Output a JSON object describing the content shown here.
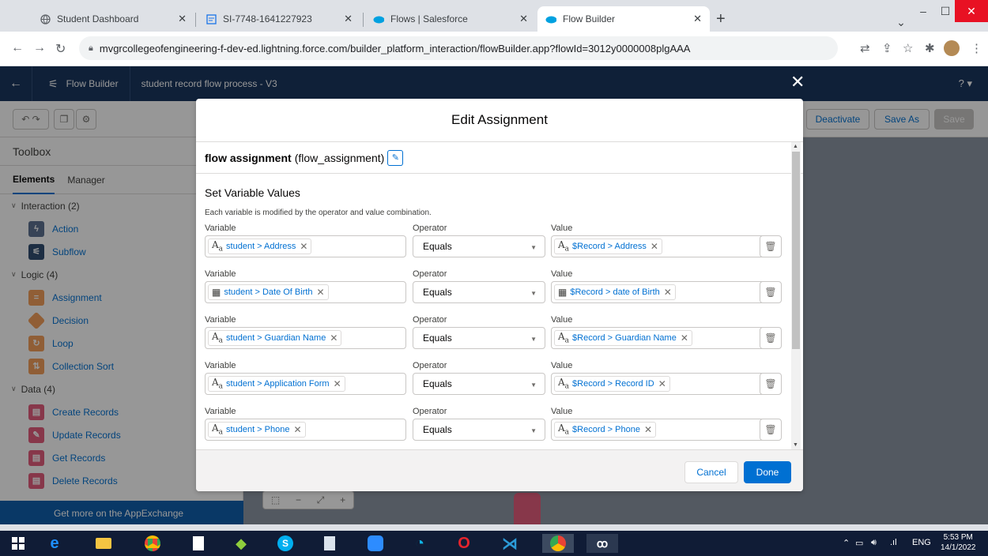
{
  "browser": {
    "tabs": [
      {
        "title": "Student Dashboard"
      },
      {
        "title": "SI-7748-1641227923"
      },
      {
        "title": "Flows | Salesforce"
      },
      {
        "title": "Flow Builder"
      }
    ],
    "url": "mvgrcollegeofengineering-f-dev-ed.lightning.force.com/builder_platform_interaction/flowBuilder.app?flowId=3012y0000008plgAAA"
  },
  "header": {
    "app": "Flow Builder",
    "flow_name": "student record flow process - V3",
    "help": "? ▾"
  },
  "toolbar": {
    "deactivate": "Deactivate",
    "save_as": "Save As",
    "save": "Save"
  },
  "toolbox": {
    "title": "Toolbox",
    "tab_elements": "Elements",
    "tab_manager": "Manager",
    "groups": [
      {
        "label": "Interaction (2)",
        "items": [
          {
            "label": "Action",
            "color": "#5a6f8f"
          },
          {
            "label": "Subflow",
            "color": "#2e4a6e"
          }
        ]
      },
      {
        "label": "Logic (4)",
        "items": [
          {
            "label": "Assignment",
            "color": "#f39e58"
          },
          {
            "label": "Decision",
            "color": "#f39e58"
          },
          {
            "label": "Loop",
            "color": "#f39e58"
          },
          {
            "label": "Collection Sort",
            "color": "#f39e58"
          }
        ]
      },
      {
        "label": "Data (4)",
        "items": [
          {
            "label": "Create Records",
            "color": "#e45a7a"
          },
          {
            "label": "Update Records",
            "color": "#e45a7a"
          },
          {
            "label": "Get Records",
            "color": "#e45a7a"
          },
          {
            "label": "Delete Records",
            "color": "#e45a7a"
          }
        ]
      }
    ],
    "appexchange": "Get more on the AppExchange"
  },
  "modal": {
    "title": "Edit Assignment",
    "api_label": "flow assignment",
    "api_name": "(flow_assignment)",
    "section_title": "Set Variable Values",
    "section_desc": "Each variable is modified by the operator and value combination.",
    "col_variable": "Variable",
    "col_operator": "Operator",
    "col_value": "Value",
    "rows": [
      {
        "variable": "student > Address",
        "var_type": "text",
        "operator": "Equals",
        "value": "$Record > Address",
        "val_type": "text"
      },
      {
        "variable": "student > Date Of Birth",
        "var_type": "date",
        "operator": "Equals",
        "value": "$Record > date of Birth",
        "val_type": "date"
      },
      {
        "variable": "student > Guardian Name",
        "var_type": "text",
        "operator": "Equals",
        "value": "$Record > Guardian Name",
        "val_type": "text"
      },
      {
        "variable": "student > Application Form",
        "var_type": "text",
        "operator": "Equals",
        "value": "$Record > Record ID",
        "val_type": "text"
      },
      {
        "variable": "student > Phone",
        "var_type": "text",
        "operator": "Equals",
        "value": "$Record > Phone",
        "val_type": "text"
      }
    ],
    "cancel": "Cancel",
    "done": "Done"
  },
  "taskbar": {
    "lang": "ENG",
    "time": "5:53 PM",
    "date": "14/1/2022"
  }
}
